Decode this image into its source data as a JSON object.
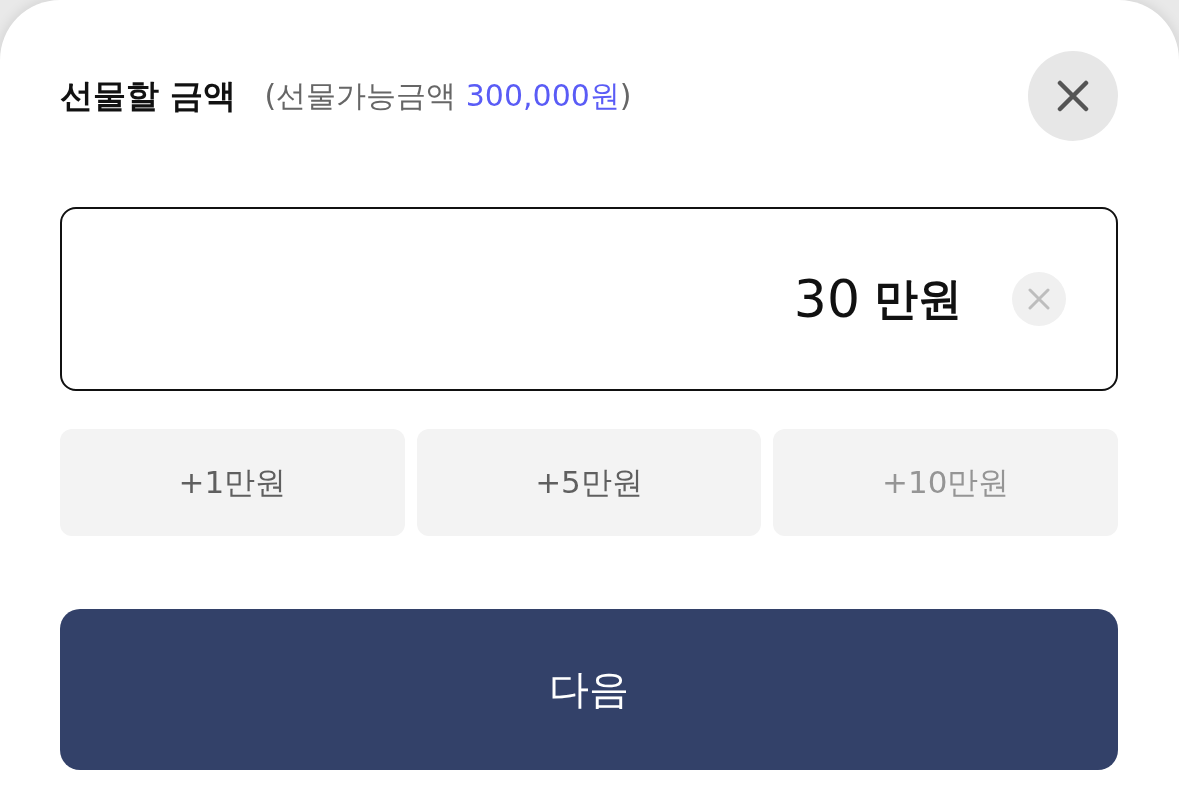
{
  "header": {
    "title": "선물할 금액",
    "note": {
      "prefix": "(선물가능금액 ",
      "amount": "300,000원",
      "suffix": ")"
    }
  },
  "amount_field": {
    "value": "30",
    "unit": "만원"
  },
  "quick_add": [
    {
      "label": "+1만원",
      "disabled": false
    },
    {
      "label": "+5만원",
      "disabled": false
    },
    {
      "label": "+10만원",
      "disabled": true
    }
  ],
  "next_button": {
    "label": "다음"
  }
}
